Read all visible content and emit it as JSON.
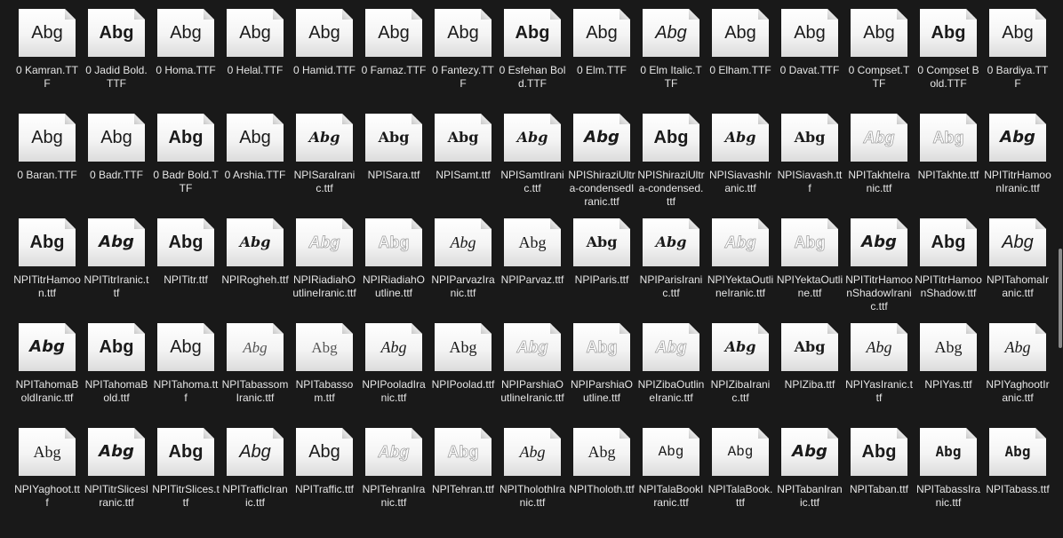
{
  "files": [
    {
      "name": "0 Kamran.TTF",
      "style": "sans"
    },
    {
      "name": "0 Jadid Bold.TTF",
      "style": "bold"
    },
    {
      "name": "0 Homa.TTF",
      "style": "sans"
    },
    {
      "name": "0 Helal.TTF",
      "style": "sans"
    },
    {
      "name": "0 Hamid.TTF",
      "style": "sans"
    },
    {
      "name": "0 Farnaz.TTF",
      "style": "sans"
    },
    {
      "name": "0 Fantezy.TTF",
      "style": "sans"
    },
    {
      "name": "0 Esfehan Bold.TTF",
      "style": "bold"
    },
    {
      "name": "0 Elm.TTF",
      "style": "sans"
    },
    {
      "name": "0 Elm Italic.TTF",
      "style": "italic"
    },
    {
      "name": "0 Elham.TTF",
      "style": "sans"
    },
    {
      "name": "0 Davat.TTF",
      "style": "sans"
    },
    {
      "name": "0 Compset.TTF",
      "style": "sans"
    },
    {
      "name": "0 Compset Bold.TTF",
      "style": "bold"
    },
    {
      "name": "0 Bardiya.TTF",
      "style": "sans"
    },
    {
      "name": "0 Baran.TTF",
      "style": "sans"
    },
    {
      "name": "0 Badr.TTF",
      "style": "sans"
    },
    {
      "name": "0 Badr Bold.TTF",
      "style": "bold"
    },
    {
      "name": "0 Arshia.TTF",
      "style": "sans"
    },
    {
      "name": "NPISaraIranic.ttf",
      "style": "serifbolditalic"
    },
    {
      "name": "NPISara.ttf",
      "style": "serifbold"
    },
    {
      "name": "NPISamt.ttf",
      "style": "serifbold"
    },
    {
      "name": "NPISamtIranic.ttf",
      "style": "serifbolditalic"
    },
    {
      "name": "NPIShiraziUltra-condensedIranic.ttf",
      "style": "bolditalic"
    },
    {
      "name": "NPIShiraziUltra-condensed.ttf",
      "style": "bold"
    },
    {
      "name": "NPISiavashIranic.ttf",
      "style": "serifbolditalic"
    },
    {
      "name": "NPISiavash.ttf",
      "style": "serifbold"
    },
    {
      "name": "NPITakhteIranic.ttf",
      "style": "outlineitalic"
    },
    {
      "name": "NPITakhte.ttf",
      "style": "outline"
    },
    {
      "name": "NPITitrHamoonIranic.ttf",
      "style": "bolditalic"
    },
    {
      "name": "NPITitrHamoon.ttf",
      "style": "bold"
    },
    {
      "name": "NPITitrIranic.ttf",
      "style": "bolditalic"
    },
    {
      "name": "NPITitr.ttf",
      "style": "bold"
    },
    {
      "name": "NPIRogheh.ttf",
      "style": "serifbolditalic"
    },
    {
      "name": "NPIRiadiahOutlineIranic.ttf",
      "style": "outlineitalic"
    },
    {
      "name": "NPIRiadiahOutline.ttf",
      "style": "outline"
    },
    {
      "name": "NPIParvazIranic.ttf",
      "style": "serifitalic"
    },
    {
      "name": "NPIParvaz.ttf",
      "style": "serif"
    },
    {
      "name": "NPIParis.ttf",
      "style": "serifbold"
    },
    {
      "name": "NPIParisIranic.ttf",
      "style": "serifbolditalic"
    },
    {
      "name": "NPIYektaOutlineIranic.ttf",
      "style": "outlineitalic"
    },
    {
      "name": "NPIYektaOutline.ttf",
      "style": "outline"
    },
    {
      "name": "NPITitrHamoonShadowIranic.ttf",
      "style": "bolditalic"
    },
    {
      "name": "NPITitrHamoonShadow.ttf",
      "style": "bold"
    },
    {
      "name": "NPITahomaIranic.ttf",
      "style": "italic"
    },
    {
      "name": "NPITahomaBoldIranic.ttf",
      "style": "bolditalic"
    },
    {
      "name": "NPITahomaBold.ttf",
      "style": "bold"
    },
    {
      "name": "NPITahoma.ttf",
      "style": "sans"
    },
    {
      "name": "NPITabassomIranic.ttf",
      "style": "lightitalic"
    },
    {
      "name": "NPITabassom.ttf",
      "style": "light"
    },
    {
      "name": "NPIPooladIranic.ttf",
      "style": "serifitalic"
    },
    {
      "name": "NPIPoolad.ttf",
      "style": "serif"
    },
    {
      "name": "NPIParshiaOutlineIranic.ttf",
      "style": "outlineitalic"
    },
    {
      "name": "NPIParshiaOutline.ttf",
      "style": "outline"
    },
    {
      "name": "NPIZibaOutlineIranic.ttf",
      "style": "outlineitalic"
    },
    {
      "name": "NPIZibaIranic.ttf",
      "style": "serifbolditalic"
    },
    {
      "name": "NPIZiba.ttf",
      "style": "serifbold"
    },
    {
      "name": "NPIYasIranic.ttf",
      "style": "serifitalic"
    },
    {
      "name": "NPIYas.ttf",
      "style": "serif"
    },
    {
      "name": "NPIYaghootIranic.ttf",
      "style": "serifitalic"
    },
    {
      "name": "NPIYaghoot.ttf",
      "style": "serif"
    },
    {
      "name": "NPITitrSlicesIranic.ttf",
      "style": "bolditalic"
    },
    {
      "name": "NPITitrSlices.ttf",
      "style": "bold"
    },
    {
      "name": "NPITrafficIranic.ttf",
      "style": "italic"
    },
    {
      "name": "NPITraffic.ttf",
      "style": "sans"
    },
    {
      "name": "NPITehranIranic.ttf",
      "style": "outlineitalic"
    },
    {
      "name": "NPITehran.ttf",
      "style": "outline"
    },
    {
      "name": "NPITholothIranic.ttf",
      "style": "serifitalic"
    },
    {
      "name": "NPITholoth.ttf",
      "style": "serif"
    },
    {
      "name": "NPITalaBookIranic.ttf",
      "style": "mono"
    },
    {
      "name": "NPITalaBook.ttf",
      "style": "mono"
    },
    {
      "name": "NPITabanIranic.ttf",
      "style": "bolditalic"
    },
    {
      "name": "NPITaban.ttf",
      "style": "bold"
    },
    {
      "name": "NPITabassIranic.ttf",
      "style": "monobold"
    },
    {
      "name": "NPITabass.ttf",
      "style": "monobold"
    }
  ],
  "sample_text": "Abg",
  "icons": {
    "file": "font-file-icon",
    "fold": "page-fold-icon"
  },
  "colors": {
    "background": "#191919",
    "label": "#e6e6e6",
    "thumb": "#ffffff"
  }
}
